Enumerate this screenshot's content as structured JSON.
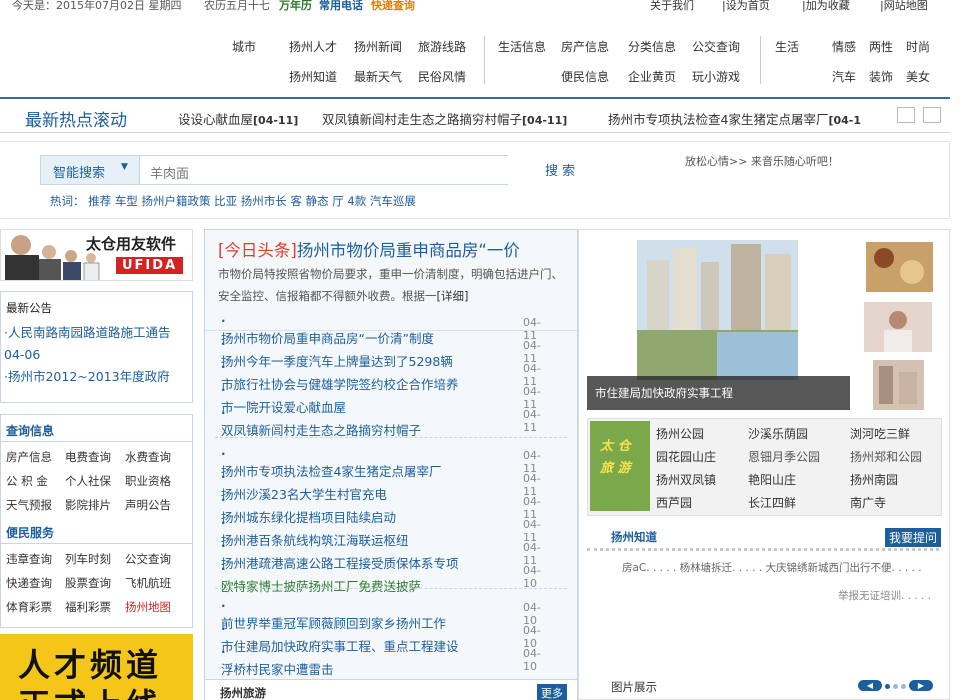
{
  "topbar": {
    "date": "今天是：2015年07月02日 星期四",
    "lunar": "农历五月十七",
    "calendar": "万年历",
    "phone": "常用电话",
    "express": "快递查询",
    "links": [
      "关于我们",
      "|设为首页",
      "|加为收藏",
      "|网站地图"
    ]
  },
  "nav": {
    "city": "城市",
    "g1r1": [
      "扬州人才",
      "扬州新闻",
      "旅游线路"
    ],
    "g1r2": [
      "扬州知道",
      "最新天气",
      "民俗风情"
    ],
    "g2r1": [
      "生活信息",
      "房产信息",
      "分类信息",
      "公交查询"
    ],
    "g2r2": [
      "便民信息",
      "企业黄页",
      "玩小游戏"
    ],
    "life": "生活",
    "g3r1": [
      "情感",
      "两性",
      "时尚"
    ],
    "g3r2": [
      "汽车",
      "装饰",
      "美女"
    ]
  },
  "hot": {
    "title": "最新热点滚动",
    "items": [
      {
        "text": "设设心献血屋",
        "date": "[04-11]"
      },
      {
        "text": "双凤镇新闾村走生态之路摘穷村帽子",
        "date": "[04-11]"
      },
      {
        "text": "扬州市专项执法检查4家生猪定点屠宰厂",
        "date": "[04-1"
      }
    ]
  },
  "search": {
    "type": "智能搜索",
    "placeholder": "羊肉面",
    "button": "搜 索",
    "hot_label": "热词：",
    "hot_words": [
      "推荐",
      "车型",
      "扬州户籍政策",
      "比亚",
      "扬州市长",
      "客",
      "静态",
      "厅",
      "4款",
      "汽车巡展"
    ],
    "music": "放松心情>> 来音乐随心听吧！"
  },
  "left": {
    "ad_text": "太仓用友软件",
    "ad_brand": "UFIDA",
    "notice_title": "最新公告",
    "notices": [
      "·人民南路南园路道路施工通告 04-06",
      "·扬州市2012~2013年度政府"
    ],
    "query_title": "查询信息",
    "query_items": [
      [
        "房产信息",
        "电费查询",
        "水费查询"
      ],
      [
        "公 积 金",
        "个人社保",
        "职业资格"
      ],
      [
        "天气预报",
        "影院排片",
        "声明公告"
      ]
    ],
    "service_title": "便民服务",
    "service_items": [
      [
        "违章查询",
        "列车时刻",
        "公交查询"
      ],
      [
        "快递查询",
        "股票查询",
        "飞机航班"
      ],
      [
        "体育彩票",
        "福利彩票",
        "扬州地图"
      ]
    ],
    "talent_l1": "人才频道",
    "talent_l2": "正式上线"
  },
  "center": {
    "headline_tag": "[今日头条]",
    "headline": "扬州市物价局重申商品房“一价",
    "summary": "市物价局特按照省物价局要求，重申一价清制度，明确包括进户门、安全监控、信报箱都不得额外收费。根据一",
    "more": "[详细]",
    "group1": [
      {
        "t": "扬州市物价局重申商品房“一价清”制度",
        "d": "04-11"
      },
      {
        "t": "扬州今年一季度汽车上牌量达到了5298辆",
        "d": "04-11"
      },
      {
        "t": "市旅行社协会与健雄学院签约校企合作培养",
        "d": "04-11"
      },
      {
        "t": "市一院开设爱心献血屋",
        "d": "04-11"
      },
      {
        "t": "双凤镇新闾村走生态之路摘穷村帽子",
        "d": "04-11"
      }
    ],
    "group2": [
      {
        "t": "扬州市专项执法检查4家生猪定点屠宰厂",
        "d": "04-11"
      },
      {
        "t": "扬州沙溪23名大学生村官充电",
        "d": "04-11"
      },
      {
        "t": "扬州城东绿化提档项目陆续启动",
        "d": "04-11"
      },
      {
        "t": "扬州港百条航线构筑江海联运枢纽",
        "d": "04-11"
      },
      {
        "t": "扬州港疏港高速公路工程接受质保体系专项",
        "d": "04-11"
      },
      {
        "t": "欧特家博士披萨扬州工厂免费送披萨",
        "d": "04-10"
      }
    ],
    "group3": [
      {
        "t": "前世界举重冠军顾薇顾回到家乡扬州工作",
        "d": "04-10"
      },
      {
        "t": "市住建局加快政府实事工程、重点工程建设",
        "d": "04-10"
      },
      {
        "t": "浮桥村民家中遭雷击",
        "d": "04-10"
      }
    ],
    "tour_title": "扬州旅游",
    "tour_more": "更多"
  },
  "right": {
    "photo_caption": "市住建局加快政府实事工程",
    "tour_logo_l1": "太 仓",
    "tour_logo_l2": "旅 游",
    "tour_rows": [
      [
        "扬州公园",
        "沙溪乐荫园",
        "浏河吃三鲜"
      ],
      [
        "园花园山庄",
        "恩钿月季公园",
        "扬州郑和公园"
      ],
      [
        "扬州双凤镇",
        "艳阳山庄",
        "扬州南园"
      ],
      [
        "西芦园",
        "长江四鲜",
        "南广寺"
      ]
    ],
    "know_title": "扬州知道",
    "ask_btn": "我要提问",
    "know_line1": "房aC. . . . . 杨林塘拆迁. . . . . 大庆锦绣新城西门出行不便. . . . .",
    "know_line2": "举报无证培训. . . . .",
    "photos_title": "图片展示"
  },
  "colors": {
    "brand": "#1d5e9c",
    "headline_red": "#e33b2e",
    "talent_yellow": "#f4c61a",
    "green": "#2b7a2b"
  }
}
